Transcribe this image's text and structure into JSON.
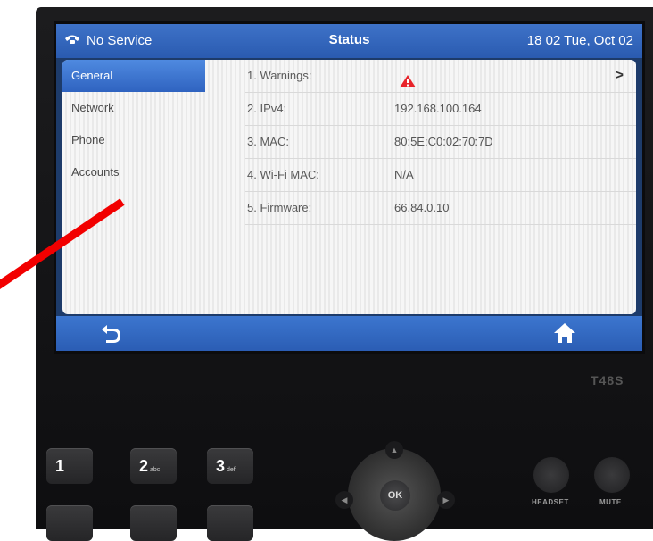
{
  "statusbar": {
    "phone_icon": "phone-icon",
    "service_status": "No Service",
    "title": "Status",
    "datetime": "18 02 Tue, Oct 02"
  },
  "sidebar": {
    "items": [
      {
        "label": "General",
        "active": true
      },
      {
        "label": "Network",
        "active": false
      },
      {
        "label": "Phone",
        "active": false
      },
      {
        "label": "Accounts",
        "active": false
      }
    ]
  },
  "status_rows": [
    {
      "label": "1. Warnings:",
      "value": "",
      "icon": "warning-icon",
      "chevron": ">"
    },
    {
      "label": "2. IPv4:",
      "value": "192.168.100.164"
    },
    {
      "label": "3. MAC:",
      "value": "80:5E:C0:02:70:7D"
    },
    {
      "label": "4. Wi-Fi MAC:",
      "value": "N/A"
    },
    {
      "label": "5. Firmware:",
      "value": "66.84.0.10"
    }
  ],
  "bottombar": {
    "back_icon": "back-icon",
    "home_icon": "home-icon"
  },
  "model_label": "T48S",
  "keypad": {
    "keys": [
      {
        "digit": "1",
        "letters": ""
      },
      {
        "digit": "2",
        "letters": "abc"
      },
      {
        "digit": "3",
        "letters": "def"
      }
    ],
    "ok_label": "OK",
    "headset_label": "HEADSET",
    "mute_label": "MUTE"
  },
  "colors": {
    "accent": "#2f63c0",
    "warning": "#e8232a",
    "annotation_arrow": "#f20000"
  }
}
